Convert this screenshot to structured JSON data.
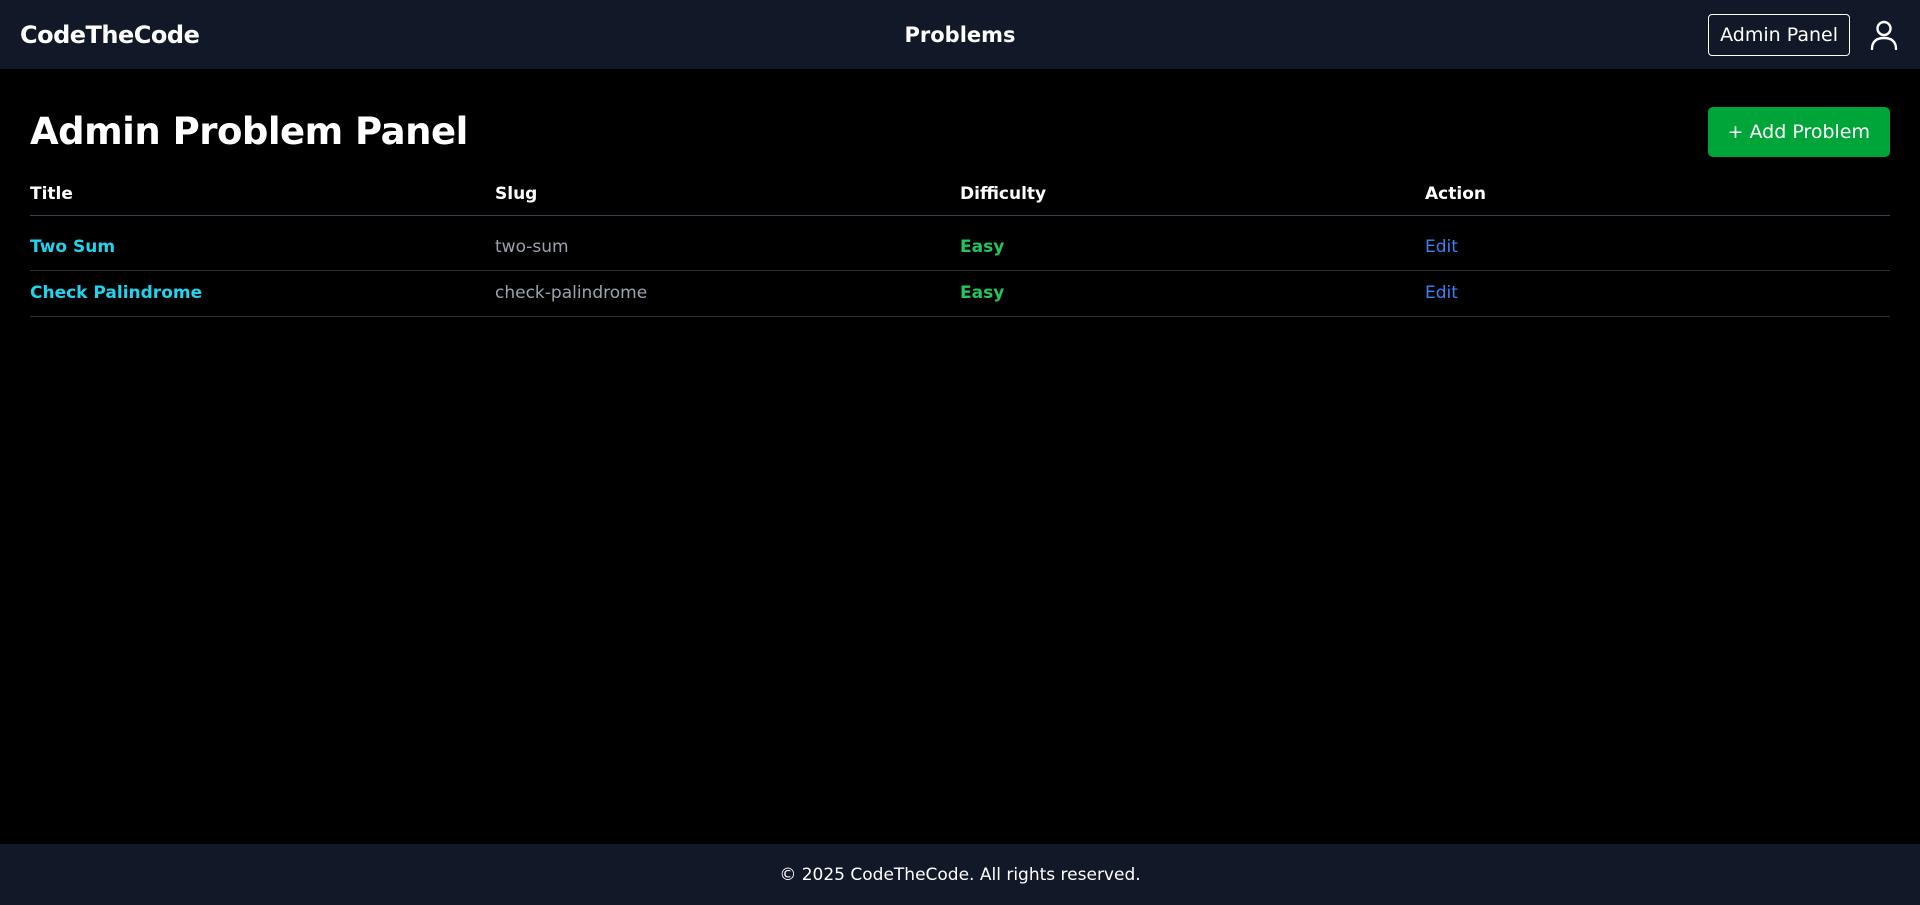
{
  "header": {
    "brand": "CodeTheCode",
    "nav_center": "Problems",
    "admin_panel_label": "Admin Panel",
    "user_icon": "user-icon"
  },
  "main": {
    "title": "Admin Problem Panel",
    "add_button_label": "+ Add Problem"
  },
  "table": {
    "columns": [
      "Title",
      "Slug",
      "Difficulty",
      "Action"
    ],
    "rows": [
      {
        "title": "Two Sum",
        "slug": "two-sum",
        "difficulty": "Easy",
        "action": "Edit"
      },
      {
        "title": "Check Palindrome",
        "slug": "check-palindrome",
        "difficulty": "Easy",
        "action": "Edit"
      }
    ]
  },
  "footer": {
    "text": "© 2025 CodeTheCode. All rights reserved."
  },
  "colors": {
    "header_bg": "#111827",
    "page_bg": "#000000",
    "title_link": "#22d3ee",
    "difficulty_easy": "#22c55e",
    "edit_link": "#3b82f6",
    "add_button": "#00a53a"
  }
}
